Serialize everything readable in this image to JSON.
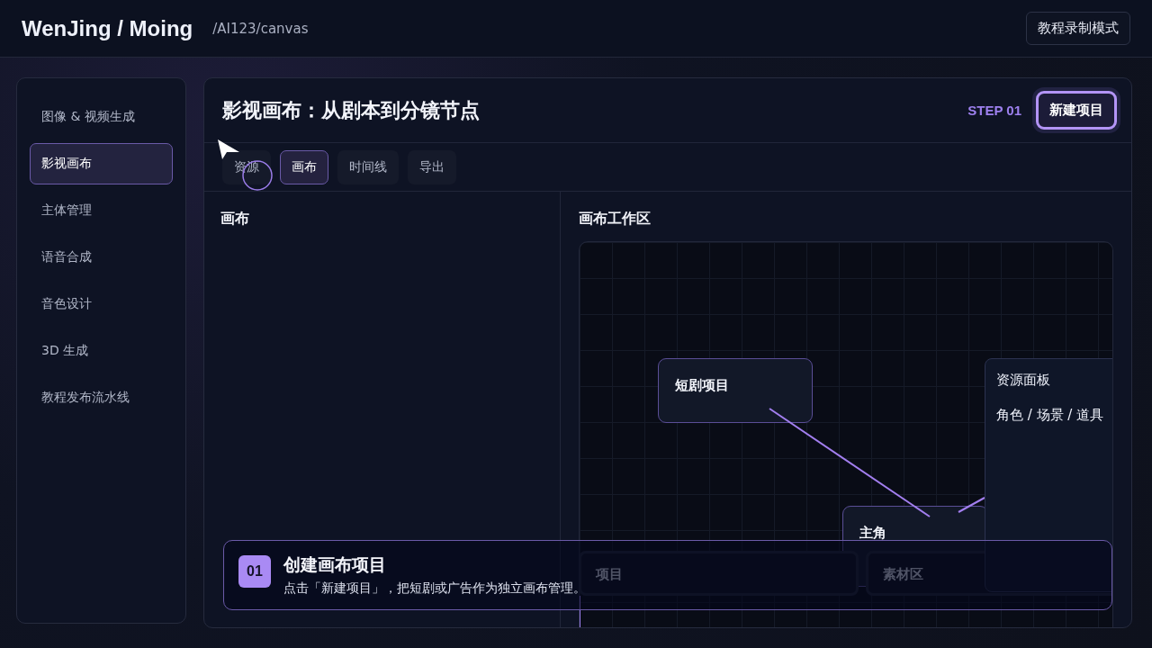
{
  "header": {
    "brand": "WenJing / Moing",
    "path": "/AI123/canvas",
    "mode_button": "教程录制模式"
  },
  "sidebar": {
    "items": [
      {
        "label": "图像 & 视频生成",
        "selected": false
      },
      {
        "label": "影视画布",
        "selected": true
      },
      {
        "label": "主体管理",
        "selected": false
      },
      {
        "label": "语音合成",
        "selected": false
      },
      {
        "label": "音色设计",
        "selected": false
      },
      {
        "label": "3D 生成",
        "selected": false
      },
      {
        "label": "教程发布流水线",
        "selected": false
      }
    ]
  },
  "main": {
    "title": "影视画布：从剧本到分镜节点",
    "step": "STEP 01",
    "primary_button": "新建项目",
    "tabs": [
      {
        "label": "资源",
        "selected": false
      },
      {
        "label": "画布",
        "selected": true
      },
      {
        "label": "时间线",
        "selected": false
      },
      {
        "label": "导出",
        "selected": false
      }
    ],
    "left_panel": {
      "title": "画布"
    },
    "workspace": {
      "title": "画布工作区",
      "nodes": [
        {
          "label": "短剧项目"
        },
        {
          "label": "主角"
        }
      ],
      "resource_panel": {
        "title": "资源面板",
        "subtitle": "角色 / 场景 / 道具"
      },
      "bottom_cards": [
        {
          "label": "项目"
        },
        {
          "label": "素材区"
        }
      ]
    }
  },
  "tutorial_toast": {
    "number": "01",
    "title": "创建画布项目",
    "text": "点击「新建项目」，把短剧或广告作为独立画布管理。"
  }
}
